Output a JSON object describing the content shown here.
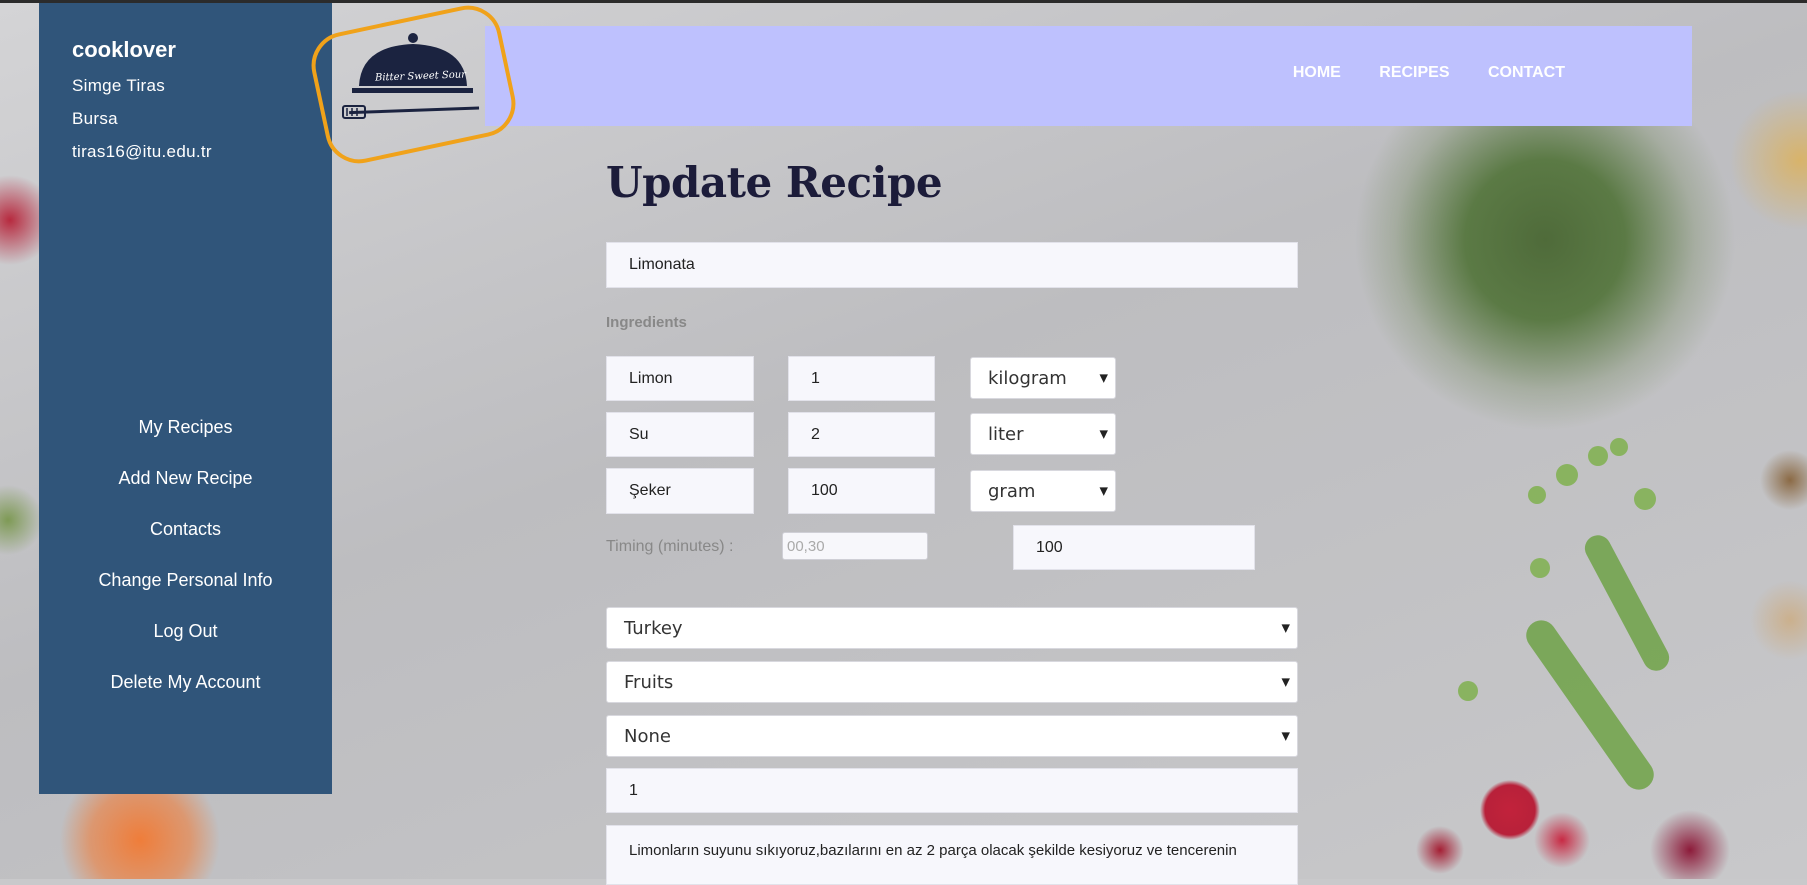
{
  "sidebar": {
    "username": "cooklover",
    "name": "Simge Tiras",
    "city": "Bursa",
    "email": "tiras16@itu.edu.tr",
    "menu": [
      "My Recipes",
      "Add New Recipe",
      "Contacts",
      "Change Personal Info",
      "Log Out",
      "Delete My Account"
    ]
  },
  "logo": {
    "text": "Bitter Sweet Sour",
    "icon": "cloche-icon",
    "accent": "#f0a21a"
  },
  "nav": {
    "links": [
      "HOME",
      "RECIPES",
      "CONTACT"
    ],
    "background": "#bec1fe"
  },
  "form": {
    "title": "Update Recipe",
    "recipe_name": "Limonata",
    "ingredients_label": "Ingredients",
    "ingredients": [
      {
        "name": "Limon",
        "amount": "1",
        "unit": "kilogram"
      },
      {
        "name": "Su",
        "amount": "2",
        "unit": "liter"
      },
      {
        "name": "Şeker",
        "amount": "100",
        "unit": "gram"
      }
    ],
    "timing_label": "Timing (minutes) :",
    "timing_placeholder": "00,30",
    "timing_value": "100",
    "country": "Turkey",
    "category": "Fruits",
    "third_select": "None",
    "servings": "1",
    "description": "Limonların suyunu sıkıyoruz,bazılarını en az 2 parça olacak şekilde kesiyoruz ve tencerenin"
  },
  "colors": {
    "sidebar": "#30557a",
    "title": "#1c1c3a"
  }
}
